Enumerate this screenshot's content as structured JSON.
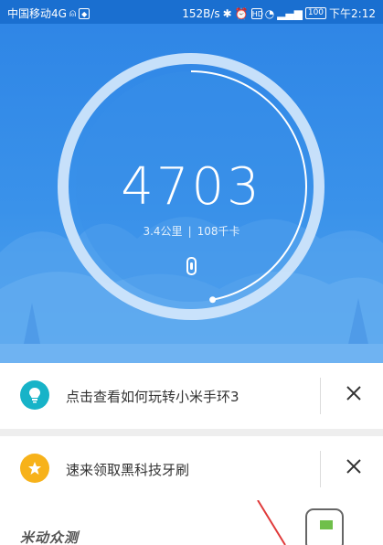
{
  "status_bar": {
    "carrier": "中国移动4G",
    "speed": "152B/s",
    "battery": "100",
    "time": "下午2:12"
  },
  "hero": {
    "steps": "4703",
    "distance": "3.4公里",
    "calories": "108千卡",
    "progress_ratio": 0.47
  },
  "cards": [
    {
      "text": "点击查看如何玩转小米手环3",
      "icon": "lightbulb-icon",
      "icon_color": "#17b3c8"
    },
    {
      "text": "速来领取黑科技牙刷",
      "icon": "star-icon",
      "icon_color": "#f7b21a"
    }
  ],
  "banner": {
    "logo_text": "米动众测"
  },
  "colors": {
    "accent": "#2f86e6",
    "status_bar": "#1a6fd0"
  }
}
